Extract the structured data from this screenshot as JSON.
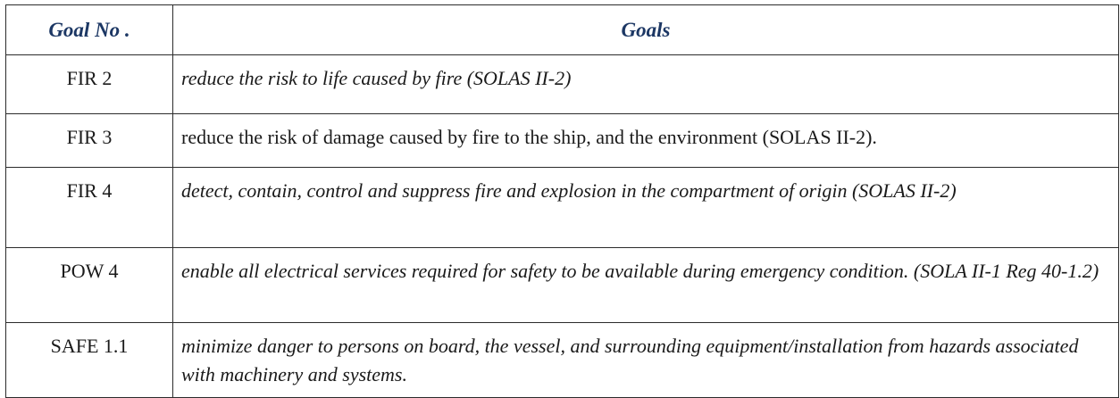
{
  "table": {
    "headers": {
      "goal_no": "Goal No .",
      "goals": "Goals"
    },
    "rows": [
      {
        "goal_no": "FIR 2",
        "goal": "reduce the risk to life caused by fire (SOLAS II-2)",
        "italic": true
      },
      {
        "goal_no": "FIR 3",
        "goal": "reduce the risk of damage caused by fire to the ship, and the environment (SOLAS II-2).",
        "italic": false
      },
      {
        "goal_no": "FIR 4",
        "goal": "detect, contain, control and suppress fire and explosion in the compartment of origin (SOLAS II-2)",
        "italic": true
      },
      {
        "goal_no": "POW 4",
        "goal": "enable all electrical services required for safety to be available during emergency condition. (SOLA II-1 Reg 40-1.2)",
        "italic": true
      },
      {
        "goal_no": "SAFE 1.1",
        "goal": "minimize danger to persons on board, the vessel, and surrounding equipment/installation from hazards associated with machinery and systems.",
        "italic": true
      }
    ]
  },
  "colors": {
    "header_text": "#1c3764",
    "border": "#2b2b2b"
  }
}
